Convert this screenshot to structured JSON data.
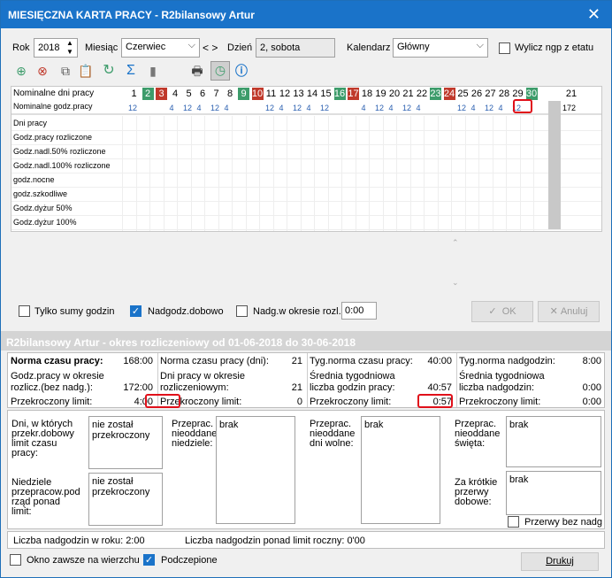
{
  "window": {
    "title": "MIESIĘCZNA KARTA PRACY - R2bilansowy Artur"
  },
  "top": {
    "rok_label": "Rok",
    "rok_value": "2018",
    "miesiac_label": "Miesiąc",
    "miesiac_value": "Czerwiec",
    "nav": "< >",
    "dzien_label": "Dzień",
    "dzien_value": "2, sobota",
    "kalendarz_label": "Kalendarz",
    "kalendarz_value": "Główny",
    "wylicz_label": "Wylicz ngp z etatu"
  },
  "grid": {
    "row1_label": "Nominalne dni pracy",
    "row2_label": "Nominalne godz.pracy",
    "days": [
      "1",
      "2",
      "3",
      "4",
      "5",
      "6",
      "7",
      "8",
      "9",
      "10",
      "11",
      "12",
      "13",
      "14",
      "15",
      "16",
      "17",
      "18",
      "19",
      "20",
      "21",
      "22",
      "23",
      "24",
      "25",
      "26",
      "27",
      "28",
      "29",
      "30"
    ],
    "day_total": "21",
    "hours": [
      "12",
      "",
      "",
      "4",
      "12",
      "4",
      "12",
      "4",
      "",
      "",
      "12",
      "4",
      "12",
      "4",
      "12",
      "",
      "",
      "4",
      "12",
      "4",
      "12",
      "4",
      "",
      "",
      "12",
      "4",
      "12",
      "4",
      "12",
      ""
    ],
    "hour_total": "172",
    "rows": [
      "Dni pracy",
      "Godz.pracy rozliczone",
      "Godz.nadl.50% rozliczone",
      "Godz.nadl.100% rozliczone",
      "godz.nocne",
      "godz.szkodliwe",
      "Godz.dyżur 50%",
      "Godz.dyżur 100%"
    ],
    "colors": {
      "green": "#3d9c6b",
      "red": "#c0392b",
      "gray": "#c8c8c8"
    }
  },
  "options": {
    "tylko_sumy": "Tylko sumy godzin",
    "nadgodz_dobowo": "Nadgodz.dobowo",
    "nadg_okres": "Nadg.w okresie rozl.",
    "nadg_okres_value": "0:00",
    "ok": "OK",
    "anuluj": "Anuluj"
  },
  "period": {
    "header": "R2bilansowy Artur - okres rozliczeniowy od 01-06-2018 do 30-06-2018",
    "c1": {
      "t1": "Norma czasu pracy:",
      "v1": "168:00",
      "t2a": "Godz.pracy w okresie",
      "t2b": "rozlicz.(bez nadg.):",
      "v2": "172:00",
      "t3": "Przekroczony limit:",
      "v3": "4:00"
    },
    "c2": {
      "t1": "Norma czasu pracy (dni):",
      "v1": "21",
      "t2a": "Dni pracy w okresie",
      "t2b": "rozliczeniowym:",
      "v2": "21",
      "t3": "Przekroczony limit:",
      "v3": "0"
    },
    "c3": {
      "t1": "Tyg.norma czasu pracy:",
      "v1": "40:00",
      "t2a": "Średnia tygodniowa",
      "t2b": "liczba godzin pracy:",
      "v2": "40:57",
      "t3": "Przekroczony limit:",
      "v3": "0:57"
    },
    "c4": {
      "t1": "Tyg.norma nadgodzin:",
      "v1": "8:00",
      "t2a": "Średnia tygodniowa",
      "t2b": "liczba nadgodzin:",
      "v2": "0:00",
      "t3": "Przekroczony limit:",
      "v3": "0:00"
    }
  },
  "lower": {
    "dni_label": [
      "Dni, w których",
      "przekr.dobowy",
      "limit czasu",
      "pracy:"
    ],
    "dni_value": [
      "nie został",
      "przekroczony"
    ],
    "niedz_label": [
      "Niedziele",
      "przepracow.pod",
      "rząd ponad",
      "limit:"
    ],
    "niedz_value": [
      "nie został",
      "przekroczony"
    ],
    "nieod_niedz_label": [
      "Przeprac.",
      "nieoddane",
      "niedziele:"
    ],
    "nieod_niedz_value": "brak",
    "nieod_wolne_label": [
      "Przeprac.",
      "nieoddane",
      "dni wolne:"
    ],
    "nieod_wolne_value": "brak",
    "nieod_swieta_label": [
      "Przeprac.",
      "nieoddane",
      "święta:"
    ],
    "nieod_swieta_value": "brak",
    "krotkie_label": [
      "Za krótkie",
      "przerwy",
      "dobowe:"
    ],
    "krotkie_value": "brak",
    "przerwy_bez": "Przerwy bez nadg"
  },
  "footer": {
    "rok": "Liczba nadgodzin w roku: 2:00",
    "limit": "Liczba nadgodzin ponad limit roczny: 0'00",
    "okno": "Okno zawsze na wierzchu",
    "podczepione": "Podczepione",
    "drukuj": "Drukuj"
  }
}
